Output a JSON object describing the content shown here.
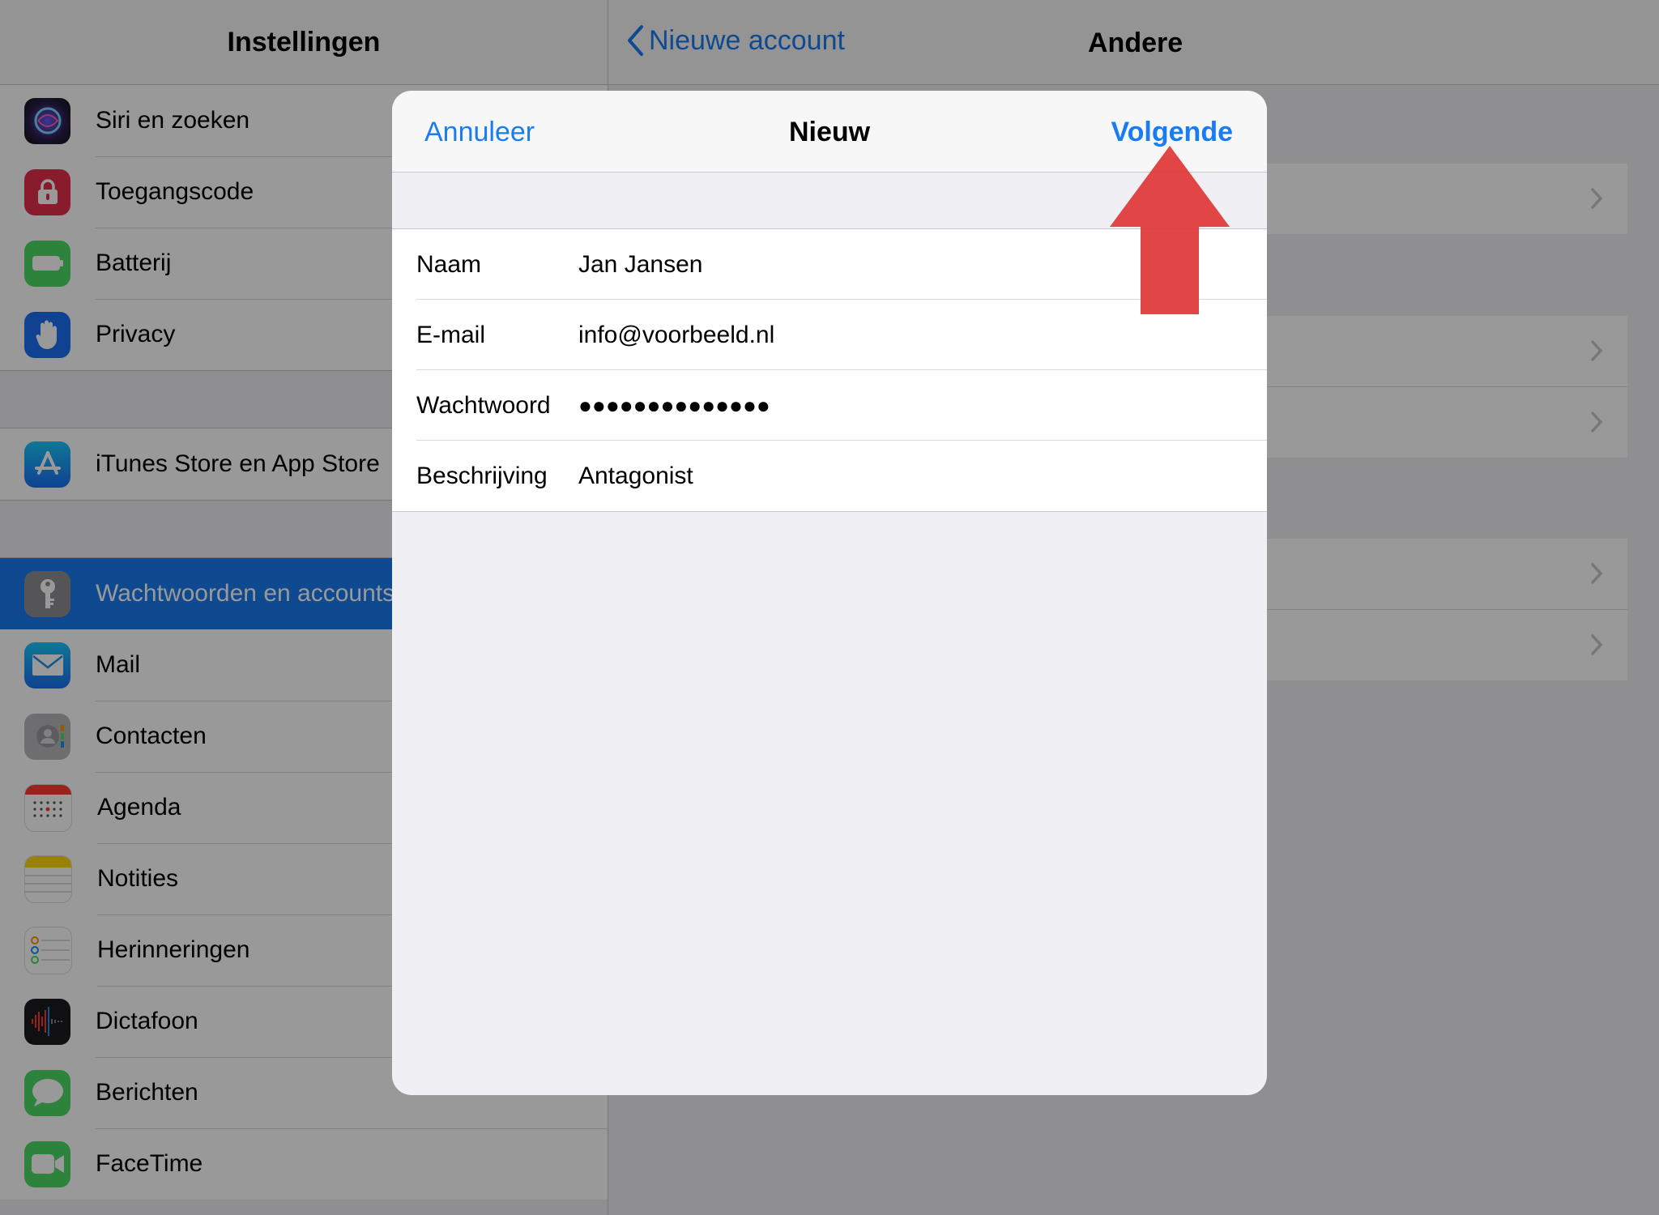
{
  "settings": {
    "title": "Instellingen",
    "group1": [
      {
        "label": "Siri en zoeken",
        "icon": "siri-icon",
        "color": "#1b1b2f"
      },
      {
        "label": "Toegangscode",
        "icon": "lock-icon",
        "color": "#e5304a"
      },
      {
        "label": "Batterij",
        "icon": "battery-icon",
        "color": "#4cd964"
      },
      {
        "label": "Privacy",
        "icon": "hand-icon",
        "color": "#1a6ef2"
      }
    ],
    "group2": [
      {
        "label": "iTunes Store en App Store",
        "icon": "app-store-icon",
        "color": "#1a8ff2"
      }
    ],
    "group3": [
      {
        "label": "Wachtwoorden en accounts",
        "icon": "key-icon",
        "color": "#8e8e93",
        "selected": true
      },
      {
        "label": "Mail",
        "icon": "envelope-icon",
        "color": "#1a8ff2"
      },
      {
        "label": "Contacten",
        "icon": "contacts-icon",
        "color": "#a5a5aa"
      },
      {
        "label": "Agenda",
        "icon": "calendar-icon",
        "color": "#ffffff"
      },
      {
        "label": "Notities",
        "icon": "notes-icon",
        "color": "#ffffff"
      },
      {
        "label": "Herinneringen",
        "icon": "reminders-icon",
        "color": "#ffffff"
      },
      {
        "label": "Dictafoon",
        "icon": "voice-memo-icon",
        "color": "#1c1c1e"
      },
      {
        "label": "Berichten",
        "icon": "messages-icon",
        "color": "#4cd964"
      },
      {
        "label": "FaceTime",
        "icon": "facetime-icon",
        "color": "#4cd964"
      }
    ]
  },
  "detail": {
    "back_label": "Nieuwe account",
    "title": "Andere"
  },
  "modal": {
    "cancel_label": "Annuleer",
    "title": "Nieuw",
    "next_label": "Volgende",
    "fields": [
      {
        "label": "Naam",
        "value": "Jan Jansen"
      },
      {
        "label": "E-mail",
        "value": "info@voorbeeld.nl"
      },
      {
        "label": "Wachtwoord",
        "value": "●●●●●●●●●●●●●●"
      },
      {
        "label": "Beschrijving",
        "value": "Antagonist"
      }
    ]
  },
  "colors": {
    "accent": "#1a7cf2",
    "arrow": "#e03b3b"
  }
}
